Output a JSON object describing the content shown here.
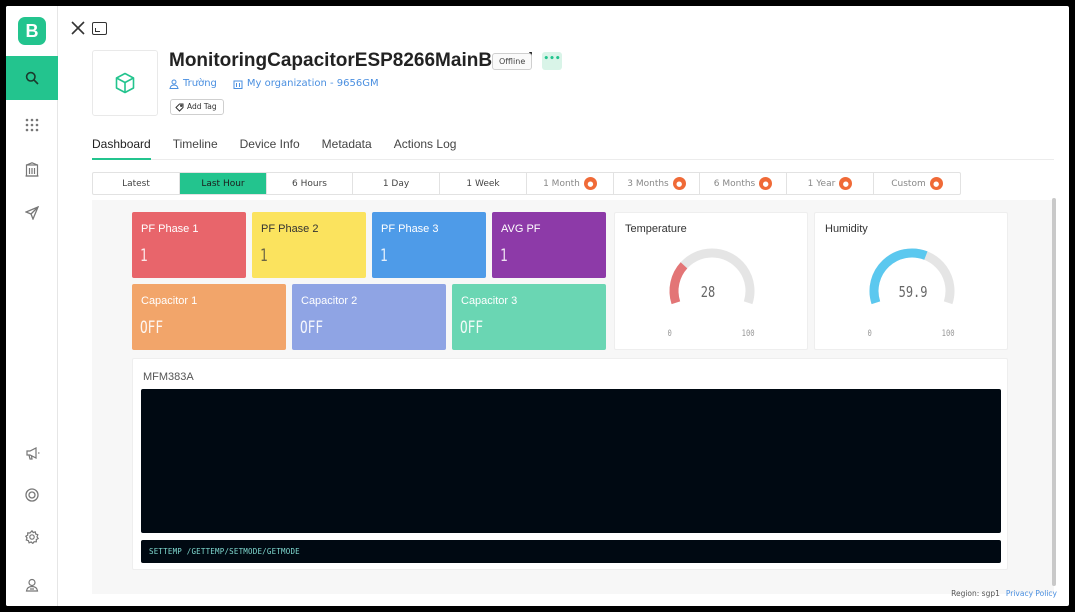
{
  "app": {
    "logo_letter": "B",
    "accent_color": "#23c48e"
  },
  "sidebar": {
    "items": [
      {
        "icon": "search-icon"
      },
      {
        "icon": "grid-icon"
      },
      {
        "icon": "building-icon"
      },
      {
        "icon": "send-icon"
      },
      {
        "icon": "megaphone-icon"
      },
      {
        "icon": "help-ring-icon"
      },
      {
        "icon": "gear-icon"
      },
      {
        "icon": "user-icon"
      }
    ]
  },
  "header": {
    "title": "MonitoringCapacitorESP8266MainBoard",
    "status": "Offline",
    "more_label": "•••",
    "owner": "Trường",
    "organization": "My organization - 9656GM",
    "add_tag": "Add Tag"
  },
  "tabs": [
    {
      "label": "Dashboard",
      "active": true
    },
    {
      "label": "Timeline"
    },
    {
      "label": "Device Info"
    },
    {
      "label": "Metadata"
    },
    {
      "label": "Actions Log"
    }
  ],
  "time_ranges": [
    {
      "label": "Latest"
    },
    {
      "label": "Last Hour",
      "active": true
    },
    {
      "label": "6 Hours"
    },
    {
      "label": "1 Day"
    },
    {
      "label": "1 Week"
    },
    {
      "label": "1 Month",
      "locked": true
    },
    {
      "label": "3 Months",
      "locked": true
    },
    {
      "label": "6 Months",
      "locked": true
    },
    {
      "label": "1 Year",
      "locked": true
    },
    {
      "label": "Custom",
      "locked": true
    }
  ],
  "tiles": [
    {
      "label": "PF Phase 1",
      "value": "1",
      "color": "#e8656b"
    },
    {
      "label": "PF Phase 2",
      "value": "1",
      "color": "#fbe35e"
    },
    {
      "label": "PF Phase 3",
      "value": "1",
      "color": "#4e9be8"
    },
    {
      "label": "AVG PF",
      "value": "1",
      "color": "#8d3aa8"
    },
    {
      "label": "Capacitor 1",
      "value": "OFF",
      "color": "#f2a56a"
    },
    {
      "label": "Capacitor 2",
      "value": "OFF",
      "color": "#8fa4e4"
    },
    {
      "label": "Capacitor 3",
      "value": "OFF",
      "color": "#6ad6b3"
    }
  ],
  "gauges": [
    {
      "title": "Temperature",
      "value": 28,
      "min": "0",
      "max": "100",
      "color": "#e37576"
    },
    {
      "title": "Humidity",
      "value": 59.9,
      "min": "0",
      "max": "100",
      "color": "#5bc8ef"
    }
  ],
  "terminal": {
    "title": "MFM383A",
    "input_text": "SETTEMP /GETTEMP/SETMODE/GETMODE"
  },
  "footer": {
    "region": "Region: sgp1",
    "privacy": "Privacy Policy"
  }
}
